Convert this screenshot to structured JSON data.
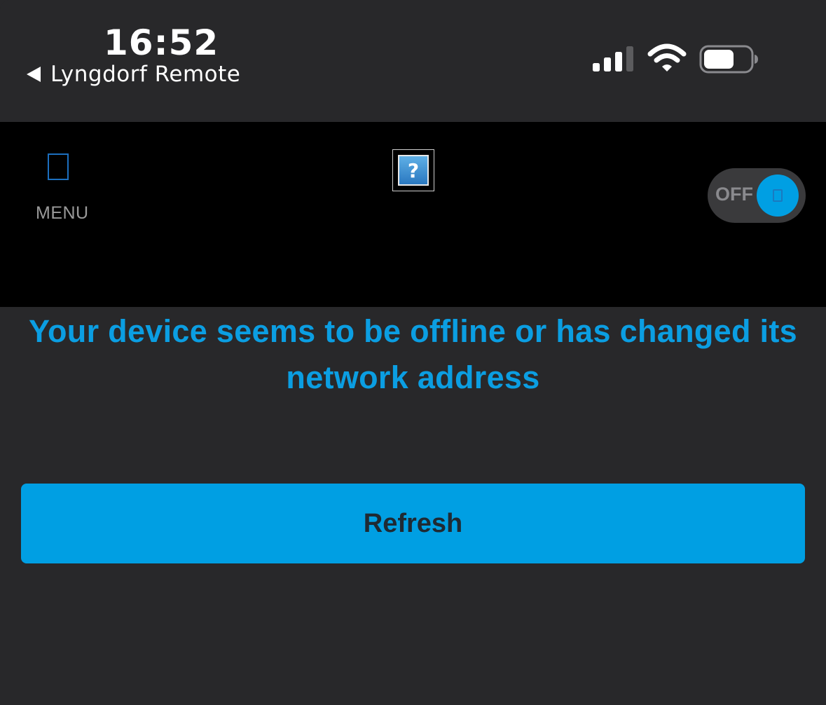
{
  "status_bar": {
    "time": "16:52",
    "back_app": "Lyngdorf Remote",
    "icons": [
      "signal-icon",
      "wifi-icon",
      "battery-icon"
    ],
    "signal_bars_active": 3,
    "signal_bars_total": 4
  },
  "header": {
    "menu_label": "MENU",
    "menu_icon": "menu-icon",
    "help_icon": "help-icon",
    "help_glyph": "?",
    "power_toggle_label": "OFF",
    "power_toggle_state": "off"
  },
  "main": {
    "message": "Your device seems to be offline or has changed its network address",
    "refresh_label": "Refresh"
  },
  "colors": {
    "background": "#28282a",
    "header_background": "#000000",
    "accent": "#009fe3",
    "message_text": "#0b9ee2",
    "button_text": "#1f2a33",
    "menu_label": "#9a9a9a"
  }
}
